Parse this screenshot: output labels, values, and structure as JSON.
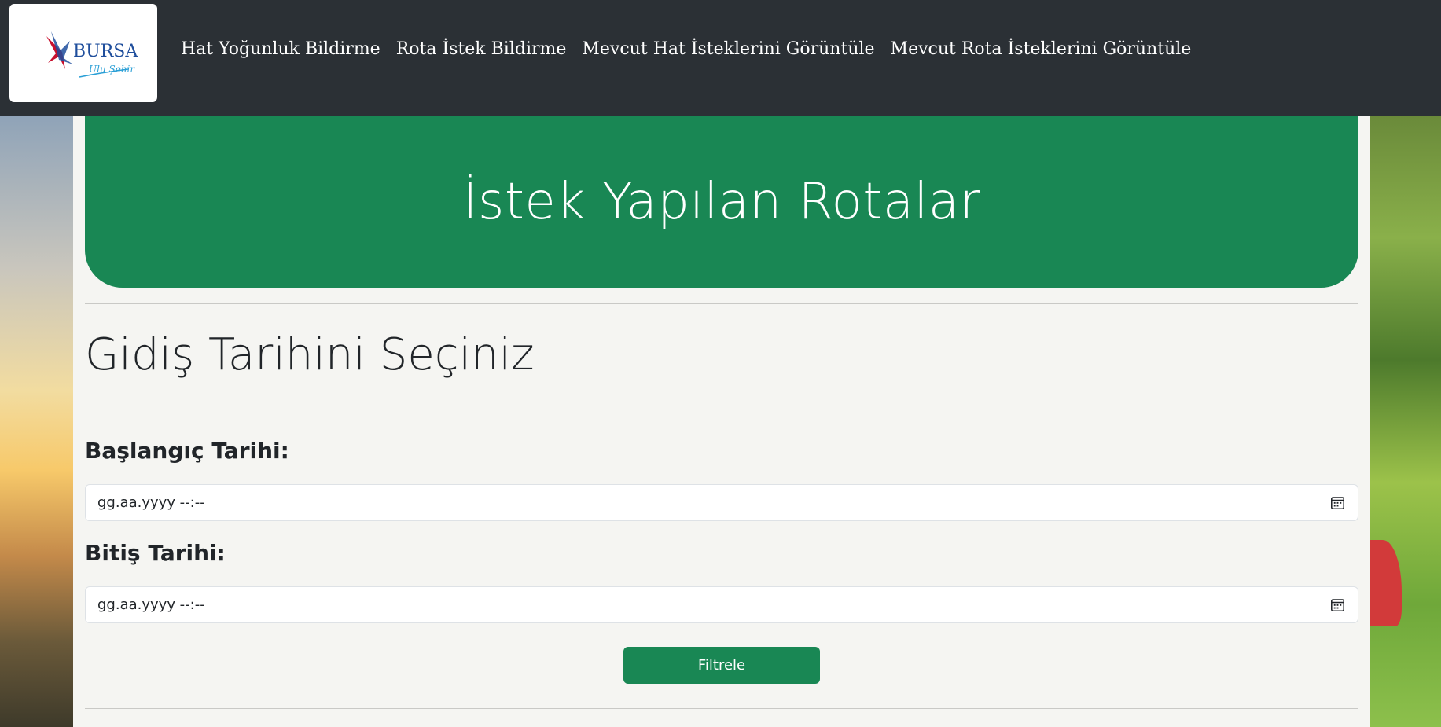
{
  "header": {
    "logo": {
      "icon": "bursa-logo-icon",
      "text": "BURSA",
      "tagline": "Ulu Şehir"
    },
    "nav": [
      {
        "label": "Hat Yoğunluk Bildirme"
      },
      {
        "label": "Rota İstek Bildirme"
      },
      {
        "label": "Mevcut Hat İsteklerini Görüntüle"
      },
      {
        "label": "Mevcut Rota İsteklerini Görüntüle"
      }
    ]
  },
  "main": {
    "hero_title": "İstek Yapılan Rotalar",
    "section_title": "Gidiş Tarihini Seçiniz",
    "start": {
      "label": "Başlangıç Tarihi:",
      "placeholder": "gg.aa.yyyy --:--",
      "icon": "calendar-icon"
    },
    "end": {
      "label": "Bitiş Tarihi:",
      "placeholder": "gg.aa.yyyy --:--",
      "icon": "calendar-icon"
    },
    "filter_button": "Filtrele"
  },
  "colors": {
    "navbar": "#2b3035",
    "accent": "#198754",
    "panel": "#f5f5f2"
  }
}
